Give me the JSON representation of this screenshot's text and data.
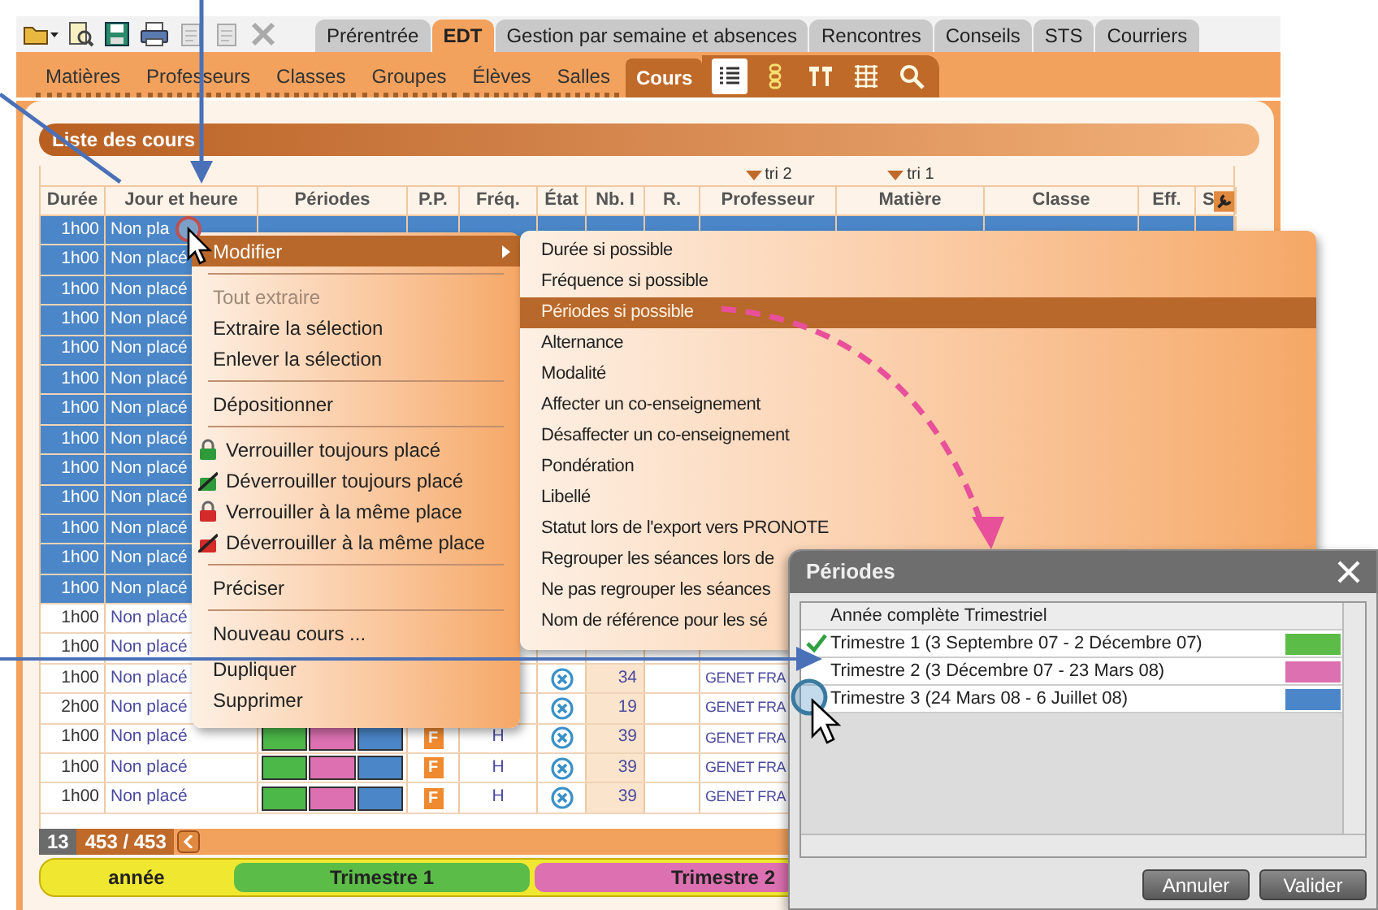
{
  "top_tabs": [
    {
      "label": "Prérentrée",
      "selected": false
    },
    {
      "label": "EDT",
      "selected": true
    },
    {
      "label": "Gestion par semaine et absences",
      "selected": false
    },
    {
      "label": "Rencontres",
      "selected": false
    },
    {
      "label": "Conseils",
      "selected": false
    },
    {
      "label": "STS",
      "selected": false
    },
    {
      "label": "Courriers",
      "selected": false
    }
  ],
  "sub_tabs": [
    {
      "label": "Matières",
      "selected": false
    },
    {
      "label": "Professeurs",
      "selected": false
    },
    {
      "label": "Classes",
      "selected": false
    },
    {
      "label": "Groupes",
      "selected": false
    },
    {
      "label": "Élèves",
      "selected": false
    },
    {
      "label": "Salles",
      "selected": false
    },
    {
      "label": "Cours",
      "selected": true
    }
  ],
  "view_buttons": [
    {
      "kind": "list",
      "selected": true
    },
    {
      "kind": "chain",
      "selected": false
    },
    {
      "kind": "pair",
      "selected": false
    },
    {
      "kind": "grid",
      "selected": false
    },
    {
      "kind": "search",
      "selected": false
    }
  ],
  "panel_title": "Liste des cours",
  "table": {
    "columns": [
      {
        "label": "Durée"
      },
      {
        "label": "Jour et heure"
      },
      {
        "label": "Périodes"
      },
      {
        "label": "P.P."
      },
      {
        "label": "Fréq."
      },
      {
        "label": "État"
      },
      {
        "label": "Nb. I"
      },
      {
        "label": "R."
      },
      {
        "label": "Professeur",
        "sort": "tri 2"
      },
      {
        "label": "Matière",
        "sort": "tri 1"
      },
      {
        "label": "Classe"
      },
      {
        "label": "Eff."
      },
      {
        "label": "S"
      }
    ],
    "rows": [
      {
        "selected": true,
        "duree": "1h00",
        "jour": "Non pla"
      },
      {
        "selected": true,
        "duree": "1h00",
        "jour": "Non placé"
      },
      {
        "selected": true,
        "duree": "1h00",
        "jour": "Non placé"
      },
      {
        "selected": true,
        "duree": "1h00",
        "jour": "Non placé"
      },
      {
        "selected": true,
        "duree": "1h00",
        "jour": "Non placé"
      },
      {
        "selected": true,
        "duree": "1h00",
        "jour": "Non placé"
      },
      {
        "selected": true,
        "duree": "1h00",
        "jour": "Non placé"
      },
      {
        "selected": true,
        "duree": "1h00",
        "jour": "Non placé"
      },
      {
        "selected": true,
        "duree": "1h00",
        "jour": "Non placé"
      },
      {
        "selected": true,
        "duree": "1h00",
        "jour": "Non placé"
      },
      {
        "selected": true,
        "duree": "1h00",
        "jour": "Non placé"
      },
      {
        "selected": true,
        "duree": "1h00",
        "jour": "Non placé"
      },
      {
        "selected": true,
        "duree": "1h00",
        "jour": "Non placé"
      },
      {
        "selected": false,
        "duree": "1h00",
        "jour": "Non placé"
      },
      {
        "selected": false,
        "duree": "1h00",
        "jour": "Non placé"
      },
      {
        "selected": false,
        "duree": "1h00",
        "jour": "Non placé",
        "cancelled": true,
        "nb": "34",
        "prof": "GENET FRA"
      },
      {
        "selected": false,
        "duree": "2h00",
        "jour": "Non placé",
        "cancelled": true,
        "nb": "19",
        "prof": "GENET FRA"
      },
      {
        "selected": false,
        "duree": "1h00",
        "jour": "Non placé",
        "periods": [
          {
            "color": "#4cb848"
          },
          {
            "color": "#dc70b0"
          },
          {
            "color": "#4a86c8"
          }
        ],
        "pp": "F",
        "freq": "H",
        "cancelled": true,
        "nb": "39",
        "prof": "GENET FRA"
      },
      {
        "selected": false,
        "duree": "1h00",
        "jour": "Non placé",
        "periods": [
          {
            "color": "#4cb848"
          },
          {
            "color": "#dc70b0"
          },
          {
            "color": "#4a86c8"
          }
        ],
        "pp": "F",
        "freq": "H",
        "cancelled": true,
        "nb": "39",
        "prof": "GENET FRA"
      },
      {
        "selected": false,
        "duree": "1h00",
        "jour": "Non placé",
        "periods": [
          {
            "color": "#4cb848"
          },
          {
            "color": "#dc70b0"
          },
          {
            "color": "#4a86c8"
          }
        ],
        "pp": "F",
        "freq": "H",
        "cancelled": true,
        "nb": "39",
        "prof": "GENET FRA"
      }
    ]
  },
  "context_menu": {
    "items": [
      {
        "kind": "item",
        "label": "Modifier",
        "selected": true,
        "has_submenu": true,
        "disabled": false
      },
      {
        "kind": "separator"
      },
      {
        "kind": "item",
        "label": "Tout extraire",
        "selected": false,
        "disabled": true
      },
      {
        "kind": "item",
        "label": "Extraire la sélection",
        "selected": false,
        "disabled": false
      },
      {
        "kind": "item",
        "label": "Enlever la sélection",
        "selected": false,
        "disabled": false
      },
      {
        "kind": "separator"
      },
      {
        "kind": "item",
        "label": "Dépositionner",
        "selected": false,
        "disabled": false
      },
      {
        "kind": "separator"
      },
      {
        "kind": "lock",
        "label": "Verrouiller toujours placé",
        "color": "#2e9a3a",
        "selected": false,
        "disabled": false
      },
      {
        "kind": "unlock",
        "label": "Déverrouiller toujours placé",
        "color": "#2e9a3a",
        "selected": false,
        "disabled": false
      },
      {
        "kind": "lock",
        "label": "Verrouiller à la même place",
        "color": "#d42a2a",
        "selected": false,
        "disabled": false
      },
      {
        "kind": "unlock",
        "label": "Déverrouiller à la même place",
        "color": "#d42a2a",
        "selected": false,
        "disabled": false
      },
      {
        "kind": "separator"
      },
      {
        "kind": "item",
        "label": "Préciser",
        "selected": false,
        "disabled": false
      },
      {
        "kind": "separator"
      },
      {
        "kind": "item",
        "label": "Nouveau cours ...",
        "selected": false,
        "disabled": false
      },
      {
        "kind": "item",
        "label": "Dupliquer",
        "selected": false,
        "disabled": false
      },
      {
        "kind": "item",
        "label": "Supprimer",
        "selected": false,
        "disabled": false
      }
    ]
  },
  "submenu": {
    "items": [
      {
        "label": "Durée si possible",
        "selected": false
      },
      {
        "label": "Fréquence si possible",
        "selected": false
      },
      {
        "label": "Périodes si possible",
        "selected": true
      },
      {
        "label": "Alternance",
        "selected": false
      },
      {
        "label": "Modalité",
        "selected": false
      },
      {
        "label": "Affecter un co-enseignement",
        "selected": false
      },
      {
        "label": "Désaffecter un co-enseignement",
        "selected": false
      },
      {
        "label": "Pondération",
        "selected": false
      },
      {
        "label": "Libellé",
        "selected": false
      },
      {
        "label": "Statut lors de l'export vers PRONOTE",
        "selected": false
      },
      {
        "label": "Regrouper les séances lors de",
        "selected": false
      },
      {
        "label": "Ne pas regrouper les séances",
        "selected": false
      },
      {
        "label": "Nom de référence pour les sé",
        "selected": false
      }
    ]
  },
  "dialog": {
    "title": "Périodes",
    "rows": [
      {
        "kind": "header",
        "label": "Année complète Trimestriel"
      },
      {
        "kind": "period",
        "label": "Trimestre 1 (3 Septembre 07 - 2 Décembre 07)",
        "checked": true,
        "color": "#5cbc48"
      },
      {
        "kind": "period",
        "label": "Trimestre 2 (3 Décembre 07 - 23 Mars 08)",
        "checked": false,
        "color": "#dc70b0"
      },
      {
        "kind": "period",
        "label": "Trimestre 3 (24 Mars 08 - 6 Juillet 08)",
        "checked": false,
        "color": "#4a86c8"
      }
    ],
    "buttons": [
      "Annuler",
      "Valider"
    ]
  },
  "footer": {
    "selected_count": "13",
    "total": "453 / 453",
    "periods": [
      {
        "label": "année",
        "color": "#f0e830"
      },
      {
        "label": "Trimestre 1",
        "color": "#5cbc48"
      },
      {
        "label": "Trimestre 2",
        "color": "#dc70b0"
      }
    ]
  }
}
